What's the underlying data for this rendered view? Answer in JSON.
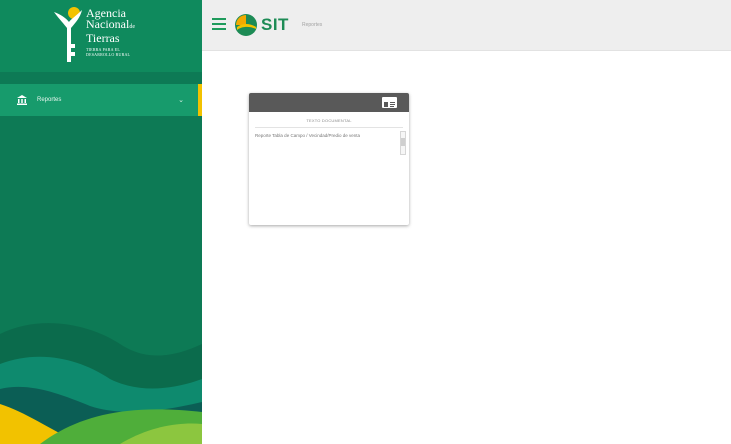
{
  "brand": {
    "logo_line1": "Agencia",
    "logo_line2": "Nacional",
    "logo_line2_suffix": "de",
    "logo_line3": "Tierras",
    "logo_tagline1": "TIERRA PARA EL",
    "logo_tagline2": "DESARROLLO RURAL"
  },
  "sidebar": {
    "items": [
      {
        "label": "Reportes",
        "icon": "bank-icon",
        "expanded": false
      }
    ],
    "accent_color": "#f2c200"
  },
  "header": {
    "app_name": "SIT",
    "breadcrumb": "Reportes",
    "menu_icon": "hamburger-icon"
  },
  "report_card": {
    "title": "TEXTO DOCUMENTAL",
    "description": "Reporte Tabla de Campo / Vecindad/Predio de venta",
    "icon": "id-card-icon"
  },
  "colors": {
    "sidebar_green": "#0d7a55",
    "nav_active_green": "#179b6c",
    "brand_green": "#1d8b55",
    "card_header": "#595959"
  }
}
